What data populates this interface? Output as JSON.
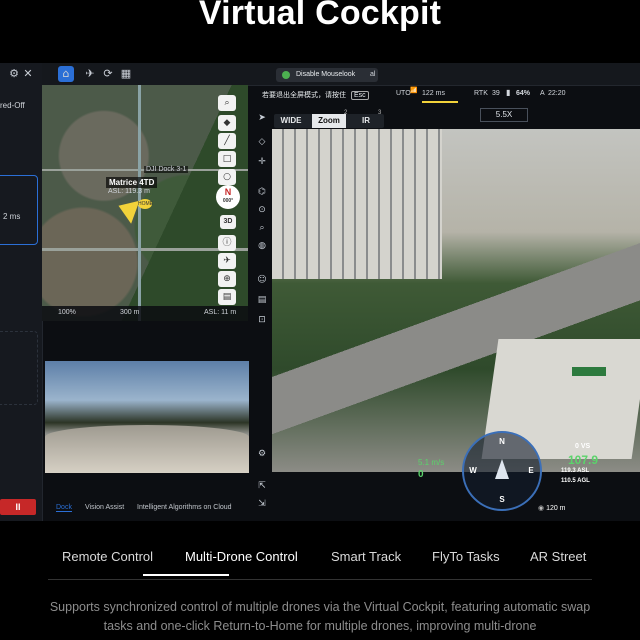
{
  "heading": "Virtual Cockpit",
  "screenshot": {
    "left_panel": {
      "status_text": "red-Off",
      "time_text": "2 ms",
      "stop_button": "II"
    },
    "topbar": {
      "settings_icon": "gear-icon",
      "close_icon": "close-icon"
    },
    "popup": {
      "label": "Disable Mouselook",
      "suffix": "al"
    },
    "hint": {
      "text": "若要退出全屏模式，请按住",
      "key": "Esc"
    },
    "flight_status": {
      "mode": "UTO",
      "latency": "122 ms",
      "rtk_label": "RTK",
      "satellites": "39",
      "battery": "64%",
      "time_label": "A",
      "time": "22:20"
    },
    "lens_tabs": [
      {
        "label": "WIDE",
        "index": ""
      },
      {
        "label": "Zoom",
        "index": "2"
      },
      {
        "label": "IR",
        "index": "3"
      }
    ],
    "zoom": "5.5X",
    "map": {
      "drone_name": "Matrice 4TD",
      "drone_asl": "ASL: 119.3 m",
      "dock_label": "DJI Dock 3-1",
      "home_label": "HOME",
      "compass_label": "N",
      "compass_deg": "000°",
      "view_3d": "3D",
      "zoom_pct": "100%",
      "scale": "300 m",
      "asl": "ASL: 11 m"
    },
    "dock_tabs": [
      "Dock",
      "Vision Assist",
      "Intelligent Algorithms on Cloud"
    ],
    "hud": {
      "speed": "5.1 m/s",
      "speed_zero": "0",
      "vs_label": "0 VS",
      "altitude": "107.9",
      "asl": "119.3 ASL",
      "agl": "110.5 AGL",
      "distance": "120 m",
      "compass_letters": [
        "N",
        "E",
        "S",
        "W"
      ]
    },
    "colors": {
      "accent_blue": "#2b6fd6",
      "hud_green": "#5bd36b",
      "stop_red": "#c62828"
    }
  },
  "feature_tabs": [
    {
      "label": "Remote Control"
    },
    {
      "label": "Multi-Drone Control"
    },
    {
      "label": "Smart Track"
    },
    {
      "label": "FlyTo Tasks"
    },
    {
      "label": "AR Street"
    }
  ],
  "active_tab": "Multi-Drone Control",
  "description": "Supports synchronized control of multiple drones via the Virtual Cockpit, featuring automatic swap tasks and one-click Return-to-Home for multiple drones, improving multi-drone"
}
